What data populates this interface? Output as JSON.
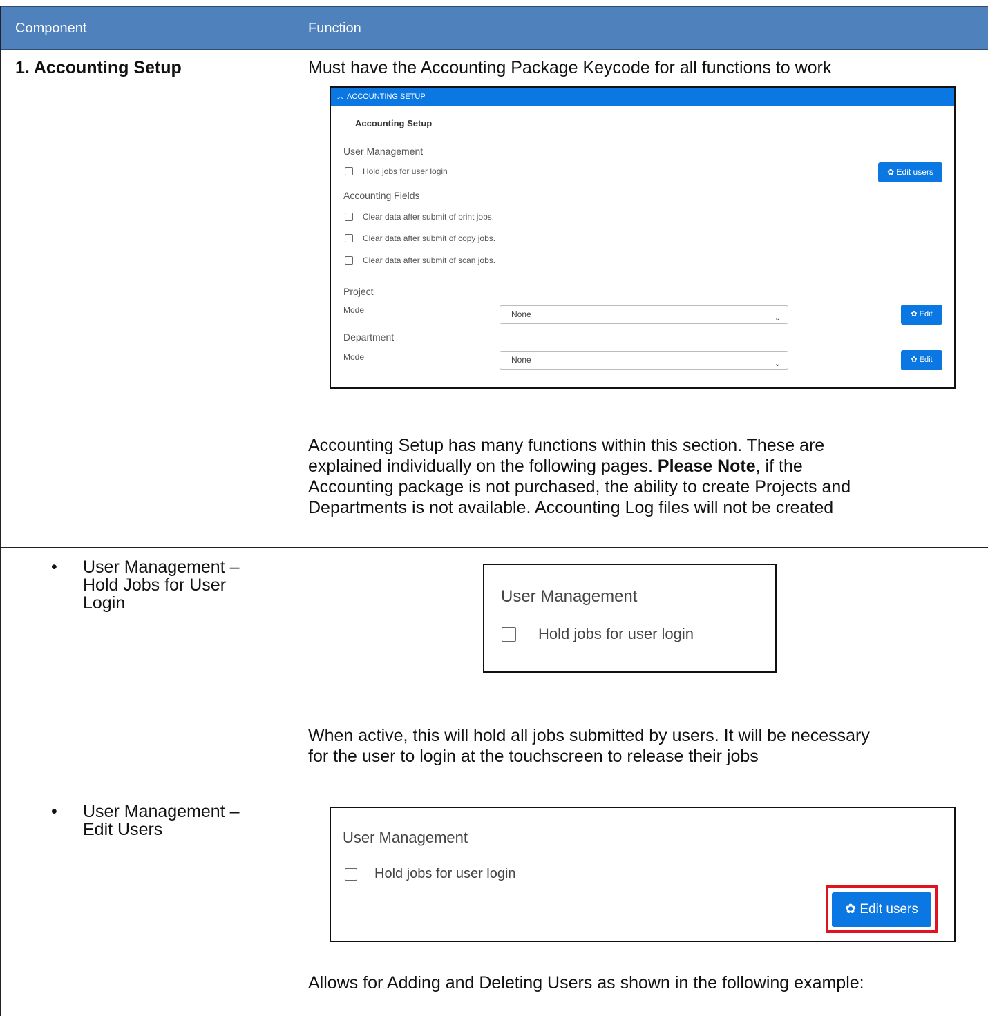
{
  "table": {
    "header": {
      "component": "Component",
      "function": "Function"
    },
    "rows": [
      {
        "component": "1.  Accounting Setup",
        "function_top": "Must have the Accounting Package Keycode for all functions to work",
        "function_bottom": [
          "Accounting Setup has many functions within this section. These are",
          "explained individually on the following pages. ",
          "Please Note",
          ", if the",
          "Accounting package is not purchased, the ability to create Projects and",
          "Departments is not available. Accounting Log files will not be created"
        ]
      },
      {
        "bullet": "•",
        "component_lines": [
          "User Management –",
          "Hold Jobs for User",
          "Login"
        ],
        "function_bottom": [
          "When active, this will hold all jobs submitted by users. It will be necessary",
          "for the user to login at the touchscreen to release their jobs"
        ]
      },
      {
        "bullet": "•",
        "component_lines": [
          "User Management –",
          "Edit Users"
        ],
        "function_bottom": [
          "Allows for Adding and Deleting Users as shown in the following example:"
        ]
      }
    ]
  },
  "shot1": {
    "bar_title": "ACCOUNTING SETUP",
    "bar_icon": "chevron-up-icon",
    "legend": "Accounting Setup",
    "user_management": "User Management",
    "hold_jobs": "Hold jobs for user login",
    "edit_users": "Edit users",
    "accounting_fields": "Accounting Fields",
    "clear_print": "Clear data after submit of print jobs.",
    "clear_copy": "Clear data after submit of copy jobs.",
    "clear_scan": "Clear data after submit of scan jobs.",
    "project": "Project",
    "mode": "Mode",
    "project_mode_value": "None",
    "edit": "Edit",
    "department": "Department",
    "department_mode_value": "None",
    "accent": "#0b77e3"
  },
  "shot2": {
    "user_management": "User Management",
    "hold_jobs": "Hold jobs for user login"
  },
  "shot3": {
    "user_management": "User Management",
    "hold_jobs": "Hold jobs for user login",
    "edit_users": "Edit users",
    "highlight_color": "#e0141e"
  },
  "colors": {
    "header_bg": "#4f81bd"
  }
}
